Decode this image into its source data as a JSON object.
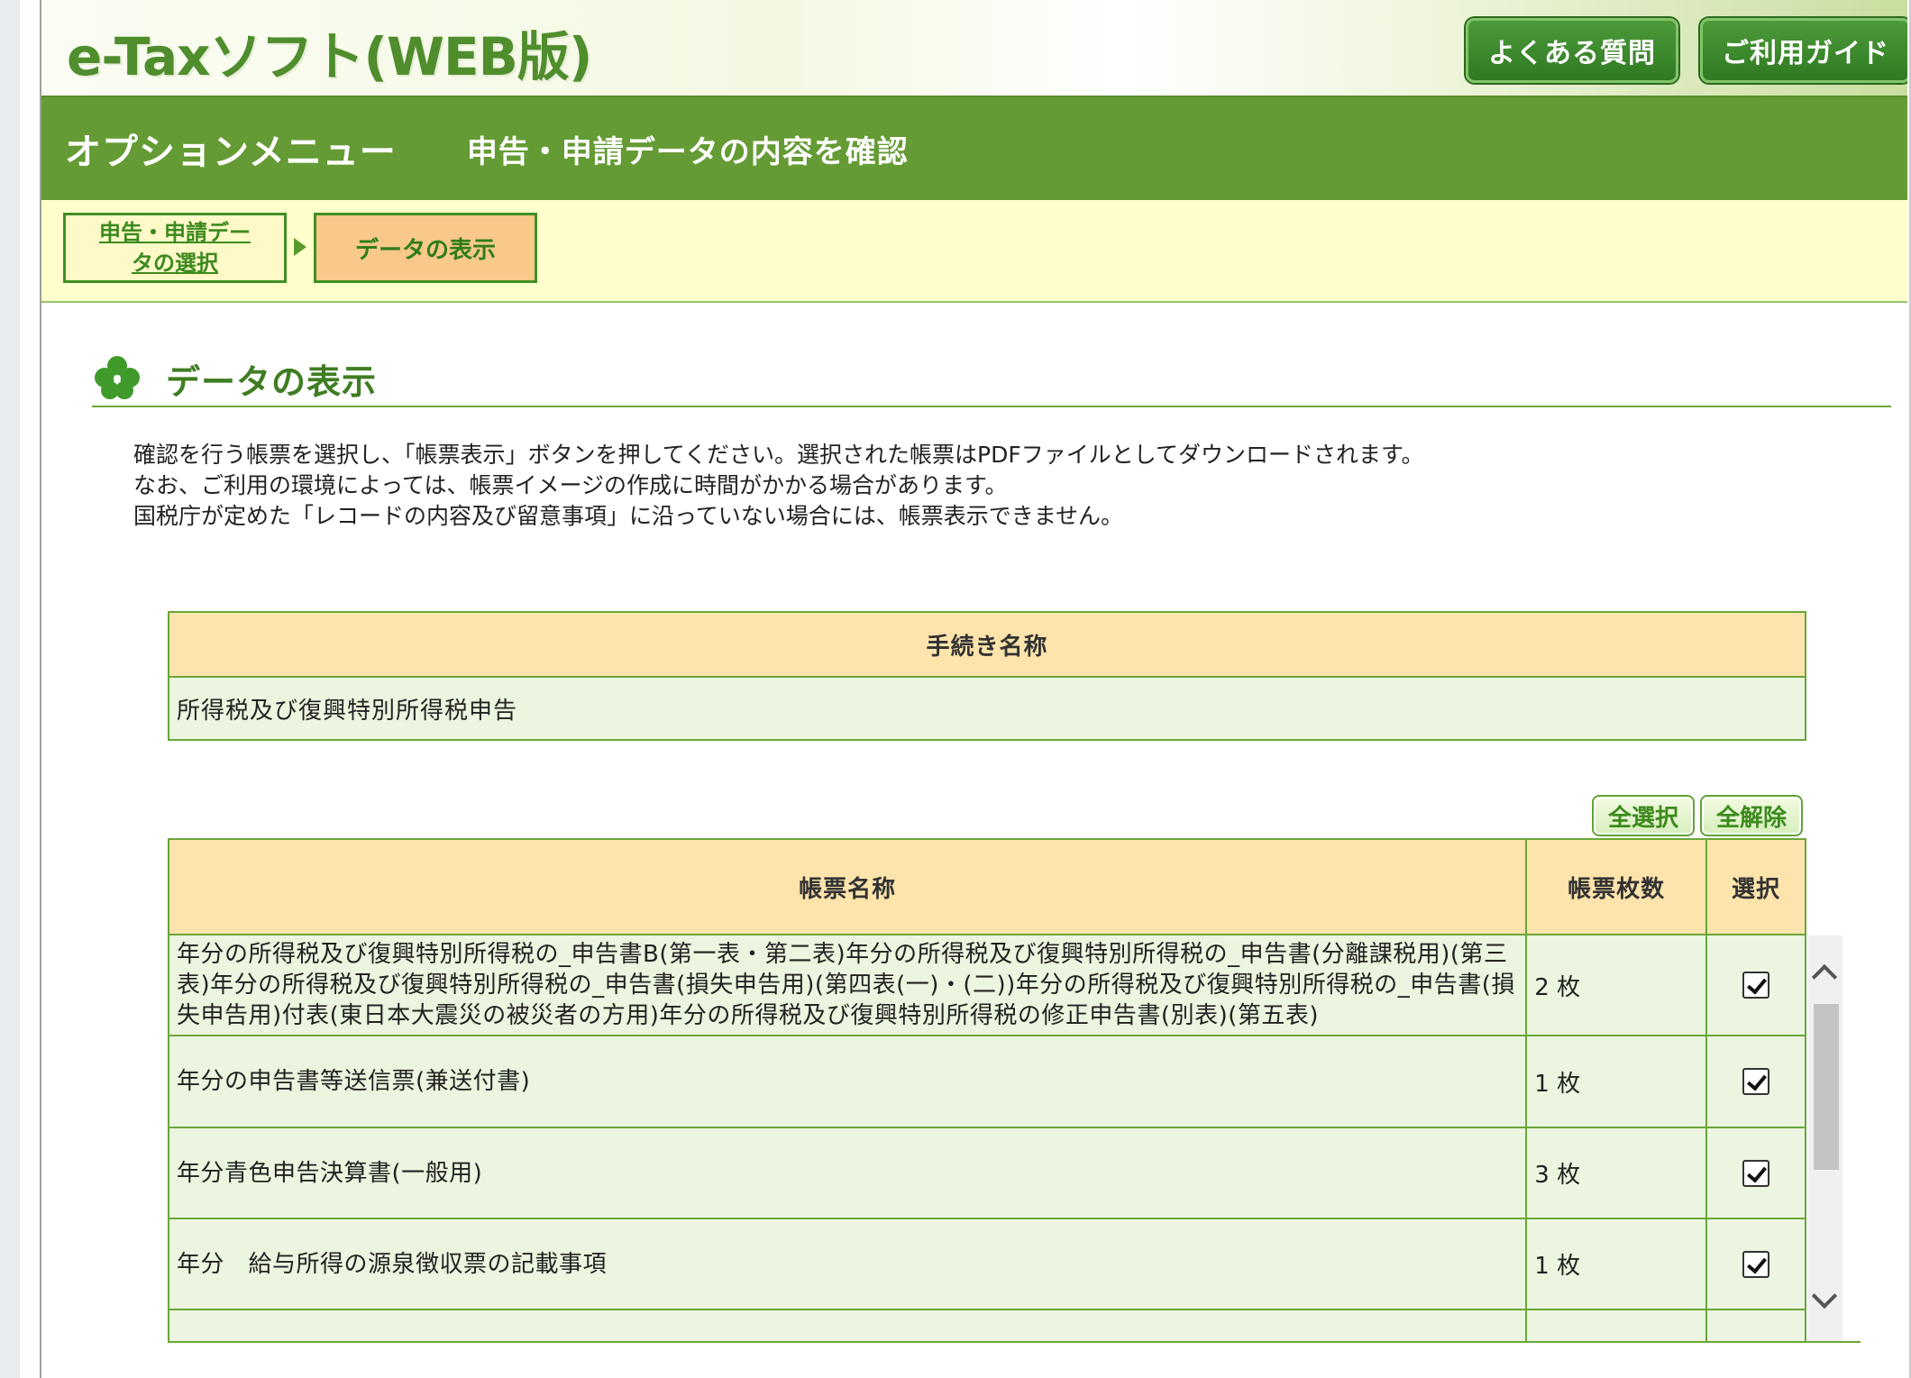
{
  "app": {
    "logo_text": "e-Taxソフト(WEB版)",
    "faq_label": "よくある質問",
    "guide_label": "ご利用ガイド"
  },
  "menubar": {
    "option_menu": "オプションメニュー",
    "page_subtitle": "申告・申請データの内容を確認"
  },
  "breadcrumb": {
    "step1": "申告・申請データの選択",
    "step2": "データの表示"
  },
  "section": {
    "title": "データの表示",
    "desc_lines": [
      "確認を行う帳票を選択し、「帳票表示」ボタンを押してください。選択された帳票はPDFファイルとしてダウンロードされます。",
      "なお、ご利用の環境によっては、帳票イメージの作成に時間がかかる場合があります。",
      "国税庁が定めた「レコードの内容及び留意事項」に沿っていない場合には、帳票表示できません。"
    ]
  },
  "procedure": {
    "header": "手続き名称",
    "value": "所得税及び復興特別所得税申告"
  },
  "buttons": {
    "select_all": "全選択",
    "deselect_all": "全解除"
  },
  "forms": {
    "headers": {
      "name": "帳票名称",
      "count": "帳票枚数",
      "select": "選択"
    },
    "rows": [
      {
        "name": "年分の所得税及び復興特別所得税の_申告書B(第一表・第二表)年分の所得税及び復興特別所得税の_申告書(分離課税用)(第三表)年分の所得税及び復興特別所得税の_申告書(損失申告用)(第四表(一)・(二))年分の所得税及び復興特別所得税の_申告書(損失申告用)付表(東日本大震災の被災者の方用)年分の所得税及び復興特別所得税の修正申告書(別表)(第五表)",
        "count": "2 枚",
        "selected": true
      },
      {
        "name": "年分の申告書等送信票(兼送付書)",
        "count": "1 枚",
        "selected": true
      },
      {
        "name": "年分青色申告決算書(一般用)",
        "count": "3 枚",
        "selected": true
      },
      {
        "name": "年分　給与所得の源泉徴収票の記載事項",
        "count": "1 枚",
        "selected": true
      }
    ]
  },
  "colors": {
    "menubar_green": "#659b34",
    "header_orange": "#fde4ac",
    "row_green": "#ebf5df",
    "breadcrumb_yellow": "#ffffcc"
  }
}
